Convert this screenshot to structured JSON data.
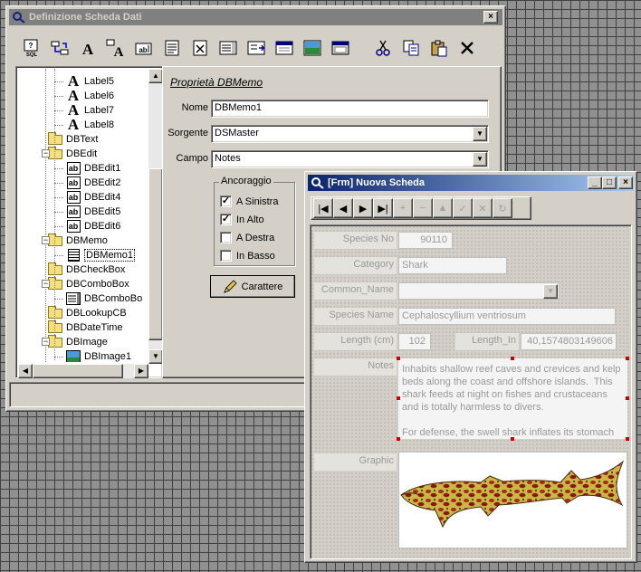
{
  "main": {
    "title": "Definizione Scheda Dati",
    "close_symbol": "×",
    "toolbar": [
      "sql-query-icon",
      "fields-icon",
      "label-icon",
      "big-label-icon",
      "edit-icon",
      "memo-icon",
      "checkbox-icon",
      "combo-icon",
      "lookup-icon",
      "date-icon",
      "image-icon",
      "panel-icon",
      "cut-icon",
      "copy-icon",
      "paste-icon",
      "delete-icon"
    ],
    "tree": {
      "items": [
        {
          "label": "Label5",
          "icon": "label"
        },
        {
          "label": "Label6",
          "icon": "label"
        },
        {
          "label": "Label7",
          "icon": "label"
        },
        {
          "label": "Label8",
          "icon": "label"
        },
        {
          "label": "DBText",
          "icon": "folder"
        },
        {
          "label": "DBEdit",
          "icon": "folder"
        },
        {
          "label": "DBEdit1",
          "icon": "edit"
        },
        {
          "label": "DBEdit2",
          "icon": "edit"
        },
        {
          "label": "DBEdit4",
          "icon": "edit"
        },
        {
          "label": "DBEdit5",
          "icon": "edit"
        },
        {
          "label": "DBEdit6",
          "icon": "edit"
        },
        {
          "label": "DBMemo",
          "icon": "folder"
        },
        {
          "label": "DBMemo1",
          "icon": "memo"
        },
        {
          "label": "DBCheckBox",
          "icon": "folder"
        },
        {
          "label": "DBComboBox",
          "icon": "folder"
        },
        {
          "label": "DBComboBo",
          "icon": "combo"
        },
        {
          "label": "DBLookupCB",
          "icon": "folder"
        },
        {
          "label": "DBDateTime",
          "icon": "folder"
        },
        {
          "label": "DBImage",
          "icon": "folder"
        },
        {
          "label": "DBImage1",
          "icon": "image"
        }
      ]
    },
    "props": {
      "title": "Proprietà DBMemo",
      "nome_label": "Nome",
      "nome_value": "DBMemo1",
      "sorgente_label": "Sorgente",
      "sorgente_value": "DSMaster",
      "campo_label": "Campo",
      "campo_value": "Notes",
      "anchor_legend": "Ancoraggio",
      "anchors": [
        {
          "label": "A Sinistra",
          "checked": true
        },
        {
          "label": "In Alto",
          "checked": true
        },
        {
          "label": "A Destra",
          "checked": false
        },
        {
          "label": "In Basso",
          "checked": false
        }
      ],
      "font_button": "Carattere"
    }
  },
  "form": {
    "title": "[Frm] Nuova Scheda",
    "nav": [
      {
        "symbol": "|◀",
        "name": "first-record-button",
        "enabled": true
      },
      {
        "symbol": "◀",
        "name": "prior-record-button",
        "enabled": true
      },
      {
        "symbol": "▶",
        "name": "next-record-button",
        "enabled": true
      },
      {
        "symbol": "▶|",
        "name": "last-record-button",
        "enabled": true
      },
      {
        "symbol": "+",
        "name": "insert-record-button",
        "enabled": false
      },
      {
        "symbol": "−",
        "name": "delete-record-button",
        "enabled": false
      },
      {
        "symbol": "▲",
        "name": "edit-record-button",
        "enabled": false
      },
      {
        "symbol": "✓",
        "name": "post-record-button",
        "enabled": false
      },
      {
        "symbol": "✕",
        "name": "cancel-record-button",
        "enabled": false
      },
      {
        "symbol": "↻",
        "name": "refresh-records-button",
        "enabled": false
      }
    ],
    "fields": {
      "species_no_label": "Species No",
      "species_no": "90110",
      "category_label": "Category",
      "category": "Shark",
      "common_name_label": "Common_Name",
      "common_name": "",
      "species_name_label": "Species Name",
      "species_name": "Cephaloscyllium ventriosum",
      "length_cm_label": "Length (cm)",
      "length_cm": "102",
      "length_in_label": "Length_In",
      "length_in": "40,1574803149606",
      "notes_label": "Notes",
      "notes": "Inhabits shallow reef caves and crevices and kelp beds along the coast and offshore islands.  This shark feeds at night on fishes and crustaceans and is totally harmless to divers.\n\nFor defense, the swell shark inflates its stomach",
      "graphic_label": "Graphic"
    }
  }
}
